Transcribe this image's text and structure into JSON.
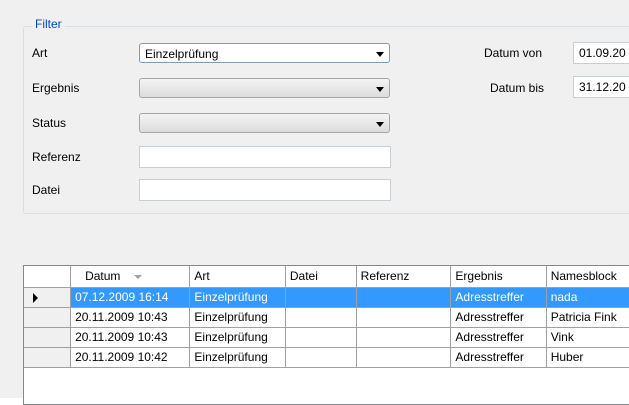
{
  "filter": {
    "legend": "Filter",
    "art_label": "Art",
    "art_value": "Einzelprüfung",
    "ergebnis_label": "Ergebnis",
    "ergebnis_value": "",
    "status_label": "Status",
    "status_value": "",
    "referenz_label": "Referenz",
    "referenz_value": "",
    "datei_label": "Datei",
    "datei_value": "",
    "datum_von_label": "Datum von",
    "datum_von_value": "01.09.20",
    "datum_bis_label": "Datum bis",
    "datum_bis_value": "31.12.20"
  },
  "grid": {
    "columns": [
      "Datum",
      "Art",
      "Datei",
      "Referenz",
      "Ergebnis",
      "Namesblock"
    ],
    "sorted_column": "Datum",
    "rows": [
      [
        "07.12.2009 16:14",
        "Einzelprüfung",
        "",
        "",
        "Adresstreffer",
        "nada"
      ],
      [
        "20.11.2009 10:43",
        "Einzelprüfung",
        "",
        "",
        "Adresstreffer",
        "Patricia Fink"
      ],
      [
        "20.11.2009 10:43",
        "Einzelprüfung",
        "",
        "",
        "Adresstreffer",
        "Vink"
      ],
      [
        "20.11.2009 10:42",
        "Einzelprüfung",
        "",
        "",
        "Adresstreffer",
        "Huber"
      ]
    ],
    "selected_row": 0
  },
  "colors": {
    "legend": "#0046d5",
    "selection": "#3399ff",
    "background": "#f0f0f0"
  }
}
